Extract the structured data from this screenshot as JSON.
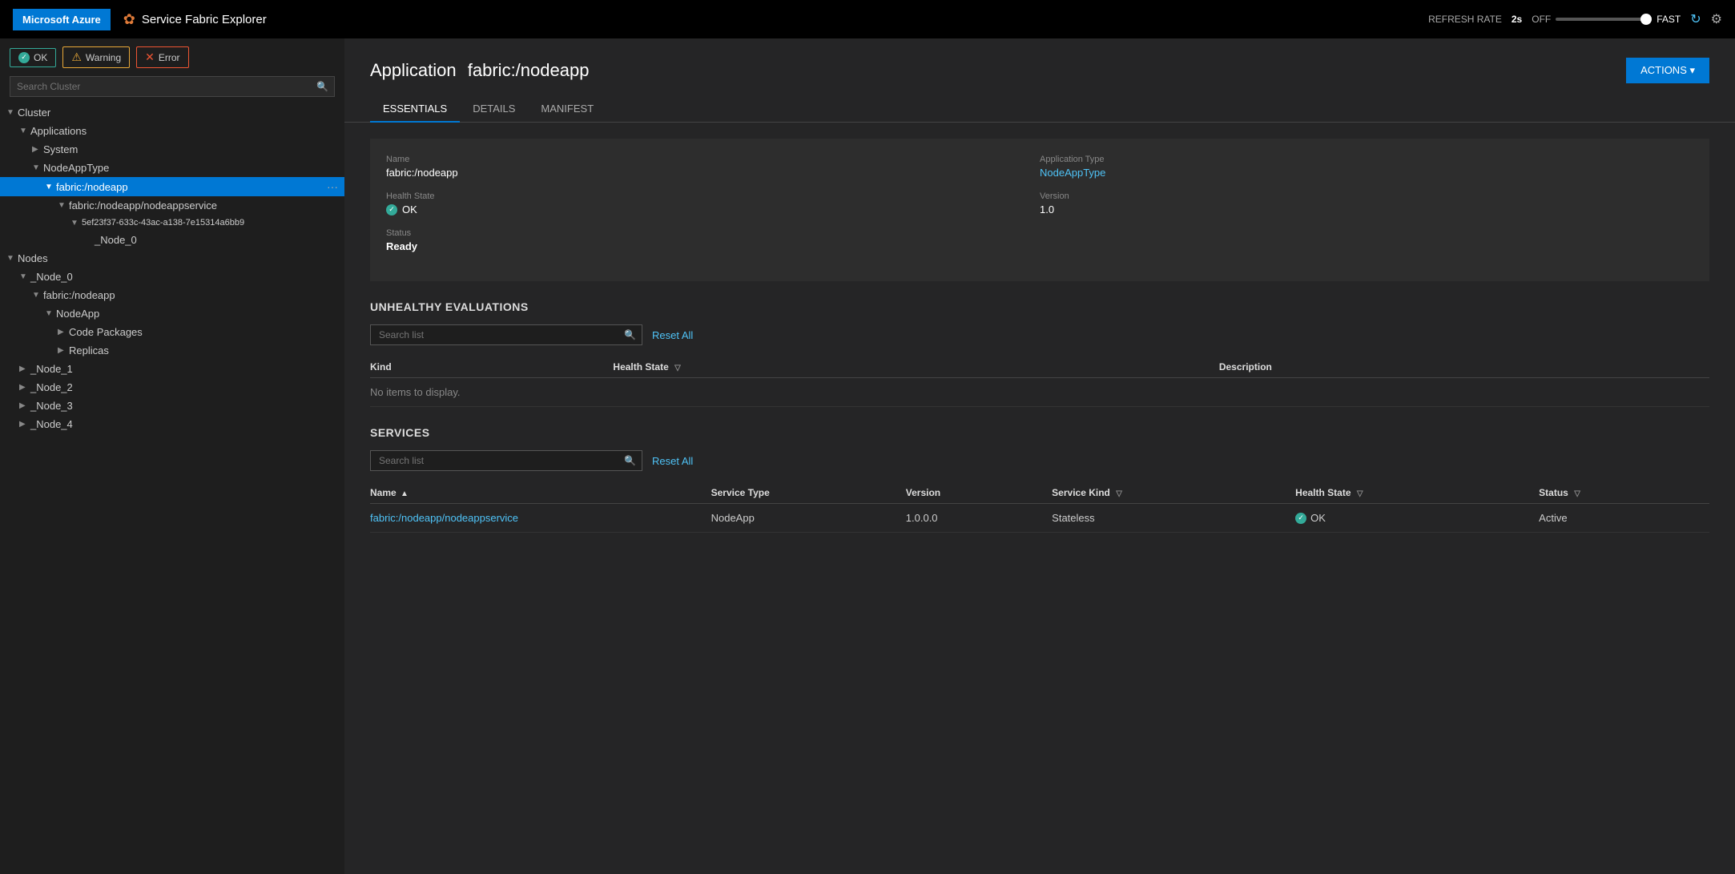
{
  "topbar": {
    "azure_label": "Microsoft Azure",
    "app_title": "Service Fabric Explorer",
    "refresh_rate_label": "REFRESH RATE",
    "refresh_rate_value": "2s",
    "off_label": "OFF",
    "fast_label": "FAST"
  },
  "sidebar": {
    "search_placeholder": "Search Cluster",
    "ok_button": "OK",
    "warning_button": "Warning",
    "error_button": "Error",
    "tree": [
      {
        "id": "cluster",
        "label": "Cluster",
        "level": 0,
        "expanded": true,
        "chevron": "▼"
      },
      {
        "id": "applications",
        "label": "Applications",
        "level": 1,
        "expanded": true,
        "chevron": "▼"
      },
      {
        "id": "system",
        "label": "System",
        "level": 2,
        "expanded": false,
        "chevron": "▶"
      },
      {
        "id": "nodeapptype",
        "label": "NodeAppType",
        "level": 2,
        "expanded": true,
        "chevron": "▼"
      },
      {
        "id": "fabric-nodeapp",
        "label": "fabric:/nodeapp",
        "level": 3,
        "expanded": true,
        "chevron": "▼",
        "selected": true,
        "dots": true
      },
      {
        "id": "fabric-nodeappservice",
        "label": "fabric:/nodeapp/nodeappservice",
        "level": 4,
        "expanded": true,
        "chevron": "▼"
      },
      {
        "id": "replica-id",
        "label": "5ef23f37-633c-43ac-a138-7e15314a6bb9",
        "level": 5,
        "expanded": true,
        "chevron": "▼"
      },
      {
        "id": "node0",
        "label": "_Node_0",
        "level": 6,
        "expanded": false,
        "chevron": ""
      },
      {
        "id": "nodes",
        "label": "Nodes",
        "level": 0,
        "expanded": true,
        "chevron": "▼"
      },
      {
        "id": "node0-top",
        "label": "_Node_0",
        "level": 1,
        "expanded": true,
        "chevron": "▼"
      },
      {
        "id": "fabric-nodeapp-2",
        "label": "fabric:/nodeapp",
        "level": 2,
        "expanded": true,
        "chevron": "▼"
      },
      {
        "id": "nodeapp-pkg",
        "label": "NodeApp",
        "level": 3,
        "expanded": true,
        "chevron": "▼"
      },
      {
        "id": "code-packages",
        "label": "Code Packages",
        "level": 4,
        "expanded": false,
        "chevron": "▶"
      },
      {
        "id": "replicas",
        "label": "Replicas",
        "level": 4,
        "expanded": false,
        "chevron": "▶"
      },
      {
        "id": "node1",
        "label": "_Node_1",
        "level": 1,
        "expanded": false,
        "chevron": "▶"
      },
      {
        "id": "node2",
        "label": "_Node_2",
        "level": 1,
        "expanded": false,
        "chevron": "▶"
      },
      {
        "id": "node3",
        "label": "_Node_3",
        "level": 1,
        "expanded": false,
        "chevron": "▶"
      },
      {
        "id": "node4",
        "label": "_Node_4",
        "level": 1,
        "expanded": false,
        "chevron": "▶"
      }
    ]
  },
  "content": {
    "page_title_prefix": "Application",
    "page_title_name": "fabric:/nodeapp",
    "actions_label": "ACTIONS ▾",
    "tabs": [
      {
        "id": "essentials",
        "label": "ESSENTIALS",
        "active": true
      },
      {
        "id": "details",
        "label": "DETAILS",
        "active": false
      },
      {
        "id": "manifest",
        "label": "MANIFEST",
        "active": false
      }
    ],
    "essentials": {
      "name_label": "Name",
      "name_value": "fabric:/nodeapp",
      "app_type_label": "Application Type",
      "app_type_value": "NodeAppType",
      "health_state_label": "Health State",
      "health_state_value": "OK",
      "version_label": "Version",
      "version_value": "1.0",
      "status_label": "Status",
      "status_value": "Ready"
    },
    "unhealthy": {
      "title": "UNHEALTHY EVALUATIONS",
      "search_placeholder": "Search list",
      "reset_all": "Reset All",
      "columns": [
        {
          "label": "Kind"
        },
        {
          "label": "Health State",
          "filter": true
        },
        {
          "label": "Description"
        }
      ],
      "empty_message": "No items to display."
    },
    "services": {
      "title": "SERVICES",
      "search_placeholder": "Search list",
      "reset_all": "Reset All",
      "columns": [
        {
          "label": "Name",
          "sort": "▲"
        },
        {
          "label": "Service Type"
        },
        {
          "label": "Version"
        },
        {
          "label": "Service Kind",
          "filter": true
        },
        {
          "label": "Health State",
          "filter": true
        },
        {
          "label": "Status",
          "filter": true
        }
      ],
      "rows": [
        {
          "name": "fabric:/nodeapp/nodeappservice",
          "service_type": "NodeApp",
          "version": "1.0.0.0",
          "service_kind": "Stateless",
          "health_state": "OK",
          "status": "Active"
        }
      ]
    }
  }
}
